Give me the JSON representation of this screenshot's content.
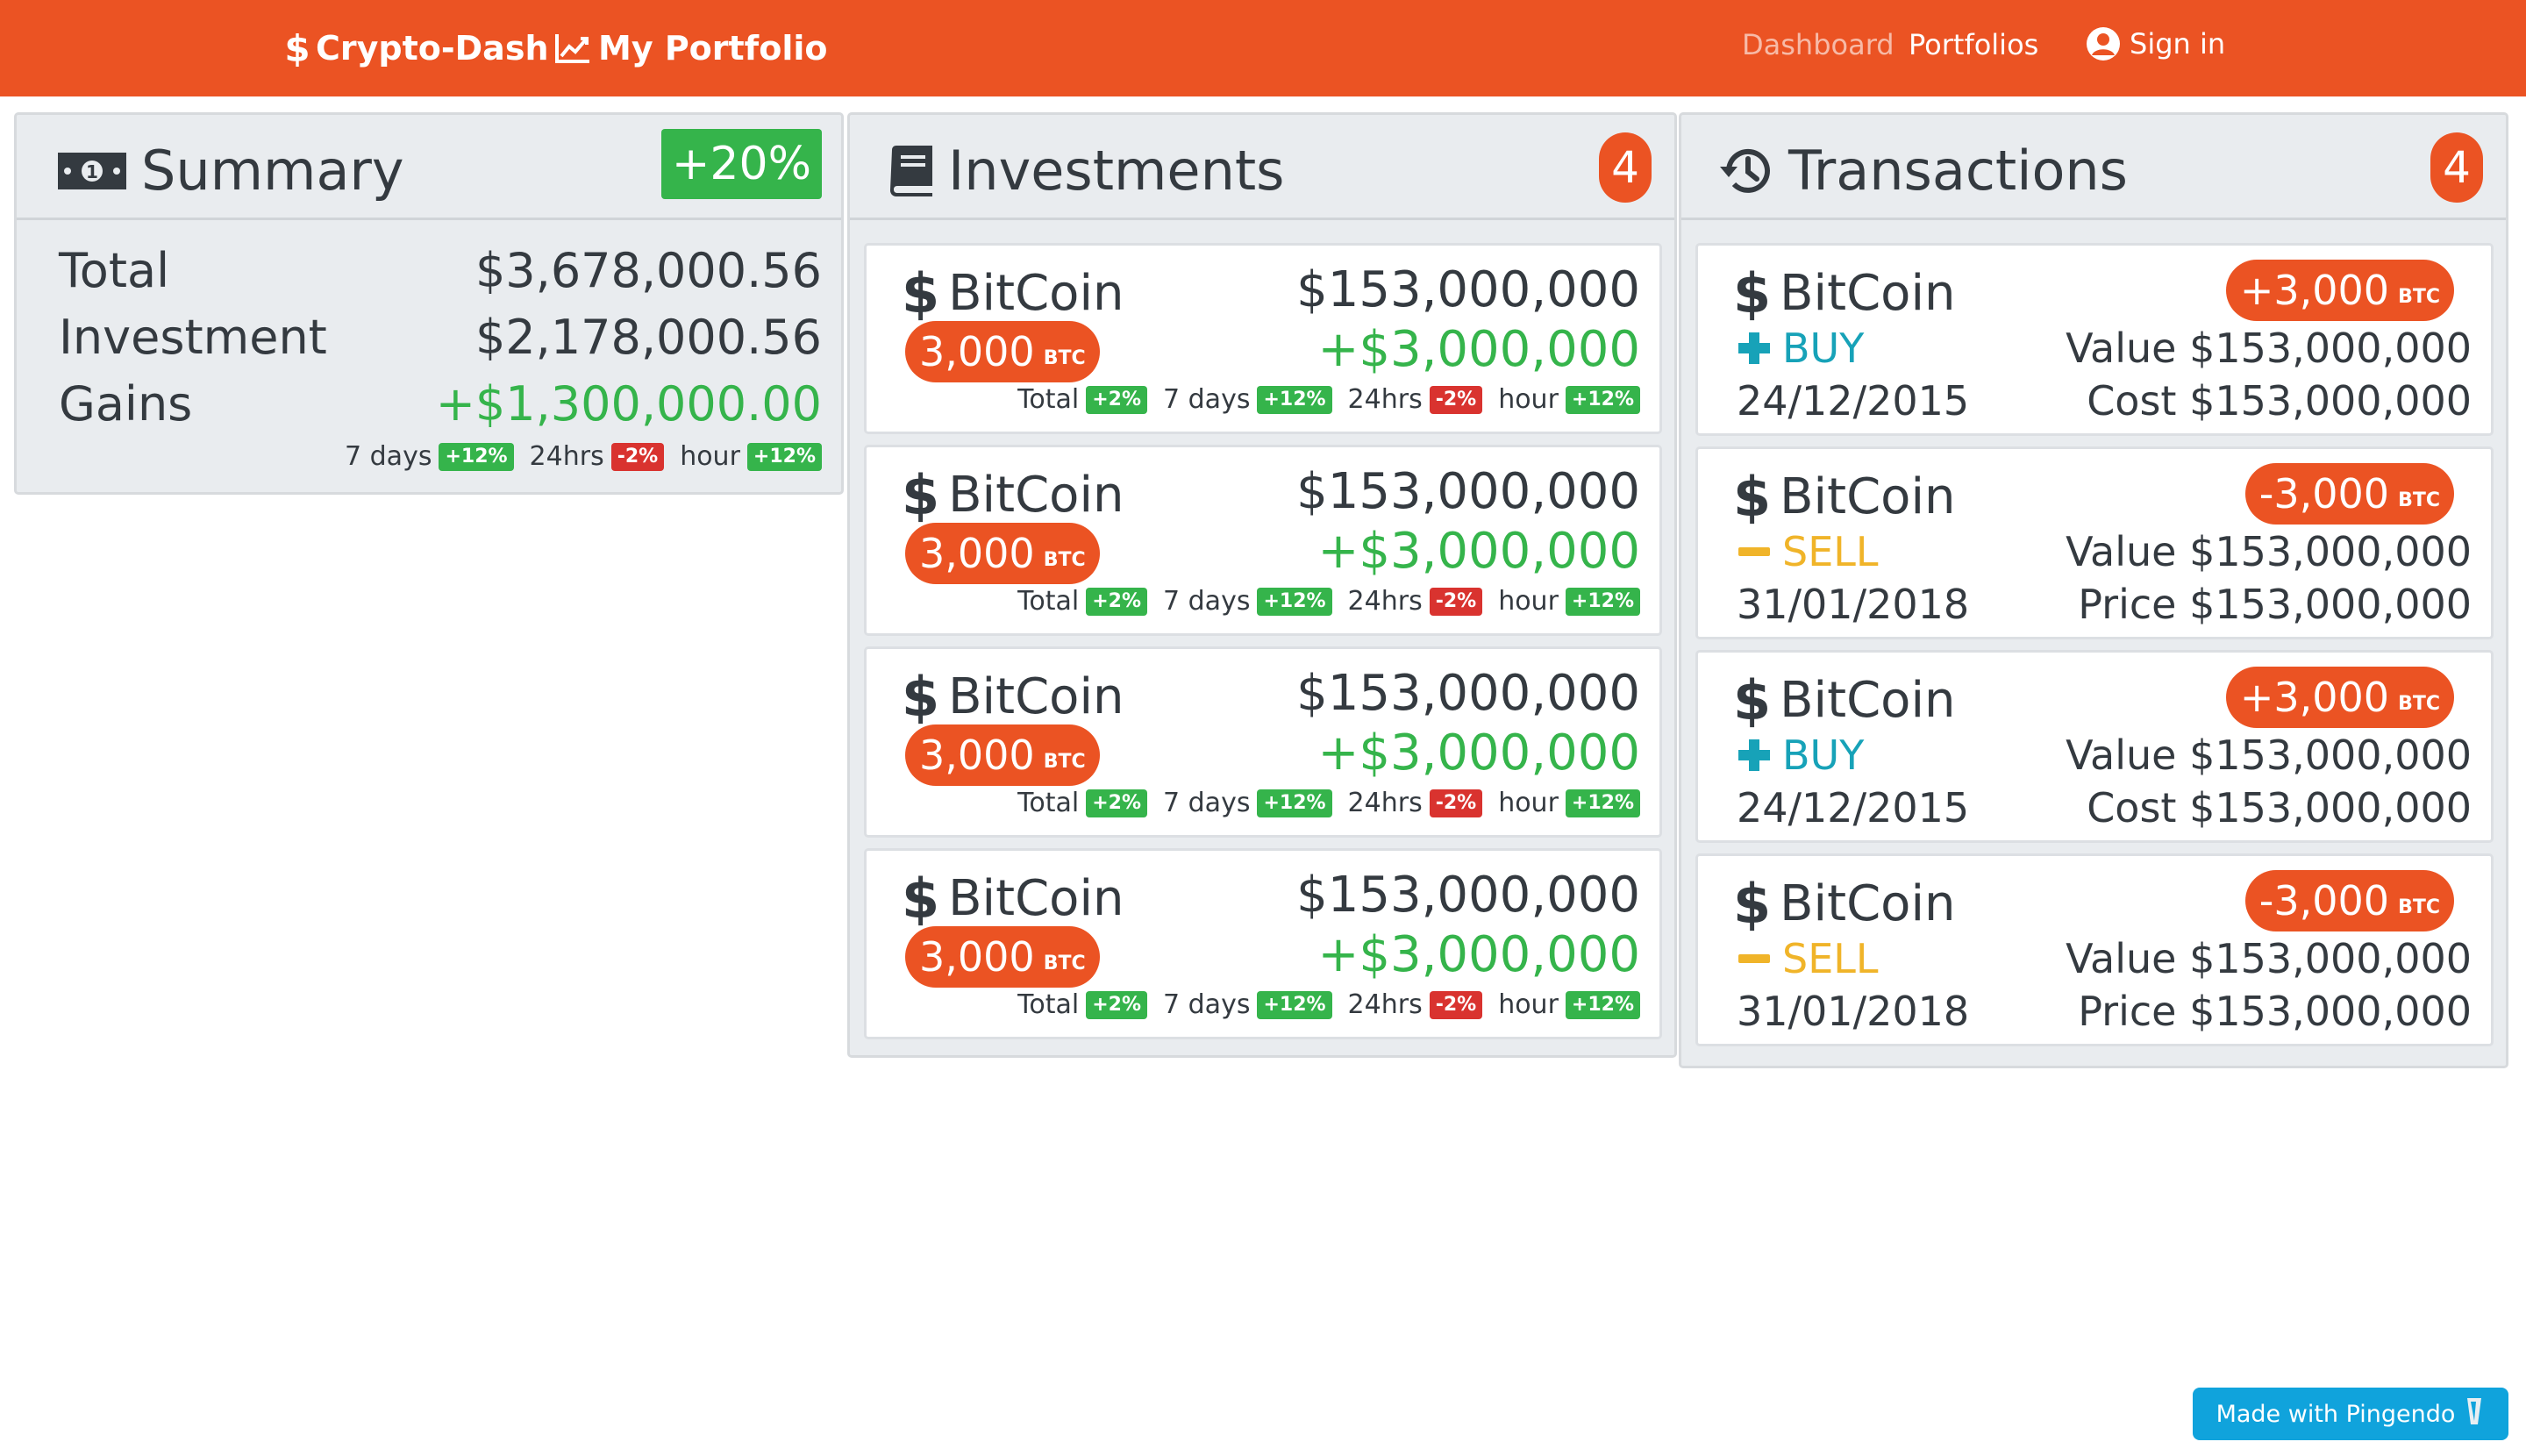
{
  "navbar": {
    "brand": "Crypto-Dash",
    "portfolio": "My Portfolio",
    "links": {
      "dashboard": "Dashboard",
      "portfolios": "Portfolios",
      "signin": "Sign in"
    },
    "background": "#eb5323"
  },
  "summary": {
    "title": "Summary",
    "badge": "+20%",
    "rows": [
      {
        "label": "Total",
        "value": "$3,678,000.56"
      },
      {
        "label": "Investment",
        "value": "$2,178,000.56"
      },
      {
        "label": "Gains",
        "value": "+$1,300,000.00"
      }
    ],
    "changes": [
      {
        "label": "7 days",
        "value": "+12%"
      },
      {
        "label": "24hrs",
        "value": "-2%"
      },
      {
        "label": "hour",
        "value": "+12%"
      }
    ]
  },
  "investments": {
    "title": "Investments",
    "count": "4",
    "items": [
      {
        "name": "BitCoin",
        "amount": "3,000",
        "unit": "BTC",
        "value": "$153,000,000",
        "gain": "+$3,000,000",
        "changes": [
          {
            "label": "Total",
            "value": "+2%"
          },
          {
            "label": "7 days",
            "value": "+12%"
          },
          {
            "label": "24hrs",
            "value": "-2%"
          },
          {
            "label": "hour",
            "value": "+12%"
          }
        ]
      },
      {
        "name": "BitCoin",
        "amount": "3,000",
        "unit": "BTC",
        "value": "$153,000,000",
        "gain": "+$3,000,000",
        "changes": [
          {
            "label": "Total",
            "value": "+2%"
          },
          {
            "label": "7 days",
            "value": "+12%"
          },
          {
            "label": "24hrs",
            "value": "-2%"
          },
          {
            "label": "hour",
            "value": "+12%"
          }
        ]
      },
      {
        "name": "BitCoin",
        "amount": "3,000",
        "unit": "BTC",
        "value": "$153,000,000",
        "gain": "+$3,000,000",
        "changes": [
          {
            "label": "Total",
            "value": "+2%"
          },
          {
            "label": "7 days",
            "value": "+12%"
          },
          {
            "label": "24hrs",
            "value": "-2%"
          },
          {
            "label": "hour",
            "value": "+12%"
          }
        ]
      },
      {
        "name": "BitCoin",
        "amount": "3,000",
        "unit": "BTC",
        "value": "$153,000,000",
        "gain": "+$3,000,000",
        "changes": [
          {
            "label": "Total",
            "value": "+2%"
          },
          {
            "label": "7 days",
            "value": "+12%"
          },
          {
            "label": "24hrs",
            "value": "-2%"
          },
          {
            "label": "hour",
            "value": "+12%"
          }
        ]
      }
    ]
  },
  "transactions": {
    "title": "Transactions",
    "count": "4",
    "items": [
      {
        "name": "BitCoin",
        "amount": "+3,000",
        "unit": "BTC",
        "type": "BUY",
        "date": "24/12/2015",
        "k1": "Value",
        "v1": "$153,000,000",
        "k2": "Cost",
        "v2": "$153,000,000"
      },
      {
        "name": "BitCoin",
        "amount": "-3,000",
        "unit": "BTC",
        "type": "SELL",
        "date": "31/01/2018",
        "k1": "Value",
        "v1": "$153,000,000",
        "k2": "Price",
        "v2": "$153,000,000"
      },
      {
        "name": "BitCoin",
        "amount": "+3,000",
        "unit": "BTC",
        "type": "BUY",
        "date": "24/12/2015",
        "k1": "Value",
        "v1": "$153,000,000",
        "k2": "Cost",
        "v2": "$153,000,000"
      },
      {
        "name": "BitCoin",
        "amount": "-3,000",
        "unit": "BTC",
        "type": "SELL",
        "date": "31/01/2018",
        "k1": "Value",
        "v1": "$153,000,000",
        "k2": "Price",
        "v2": "$153,000,000"
      }
    ]
  },
  "footer": {
    "pingendo": "Made with Pingendo"
  },
  "colors": {
    "accent": "#eb5323",
    "positive": "#35b44b",
    "negative": "#d9332f",
    "buy": "#17a2b8",
    "sell": "#f0b429"
  }
}
